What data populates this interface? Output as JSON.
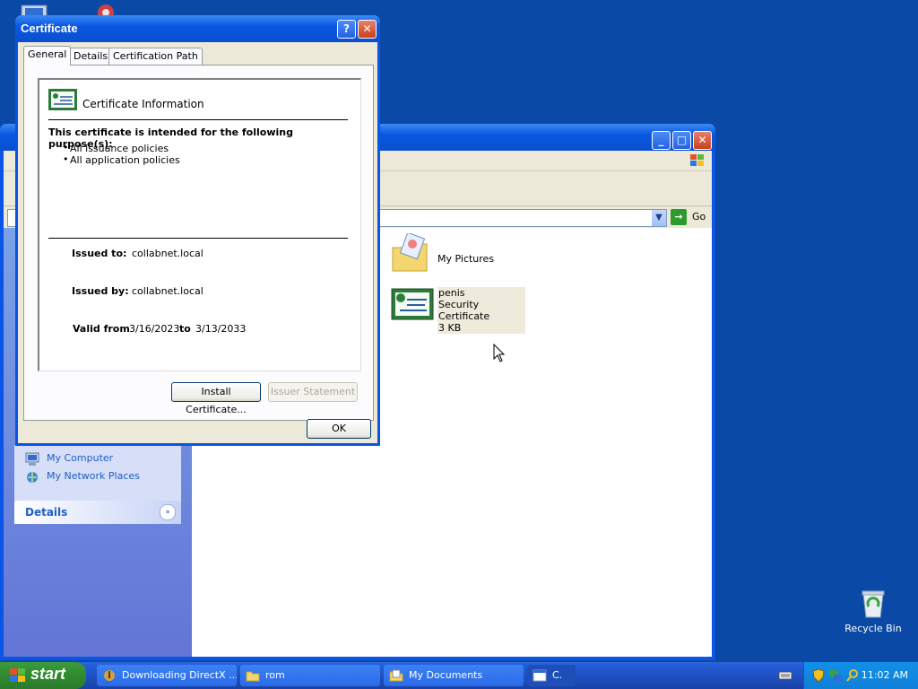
{
  "desktop": {
    "recycle_bin_label": "Recycle Bin"
  },
  "explorer": {
    "go_label": "Go",
    "left_pane": {
      "links": [
        "My Computer",
        "My Network Places"
      ],
      "details_label": "Details"
    },
    "files": [
      {
        "name": "My Pictures",
        "icon": "pictures-folder-icon"
      },
      {
        "name": "penis",
        "type": "Security Certificate",
        "size": "3 KB",
        "icon": "certificate-icon"
      }
    ]
  },
  "dialog": {
    "title": "Certificate",
    "help_glyph": "?",
    "close_glyph": "✕",
    "tabs": [
      "General",
      "Details",
      "Certification Path"
    ],
    "active_tab": "General",
    "info_title": "Certificate Information",
    "purpose_heading": "This certificate is intended for the following purpose(s):",
    "purposes": [
      "All issuance policies",
      "All application policies"
    ],
    "issued_to_label": "Issued to:",
    "issued_to": "collabnet.local",
    "issued_by_label": "Issued by:",
    "issued_by": "collabnet.local",
    "valid_from_label": "Valid from",
    "valid_from": "3/16/2023",
    "valid_to_label": "to",
    "valid_to": "3/13/2033",
    "install_button": "Install Certificate...",
    "issuer_statement_button": "Issuer Statement",
    "ok_button": "OK"
  },
  "taskbar": {
    "start_label": "start",
    "items": [
      {
        "label": "Downloading DirectX ...",
        "icon": "download-icon"
      },
      {
        "label": "rom",
        "icon": "folder-icon"
      },
      {
        "label": "My Documents",
        "icon": "folder-icon"
      },
      {
        "label": "C.",
        "icon": "window-icon"
      }
    ],
    "clock": "11:02 AM"
  },
  "colors": {
    "desktop": "#0a4aa6",
    "titlebar": "#0a58e0",
    "dialog_face": "#ece9d8",
    "link": "#215dc6",
    "start_green": "#2f8a2f"
  }
}
